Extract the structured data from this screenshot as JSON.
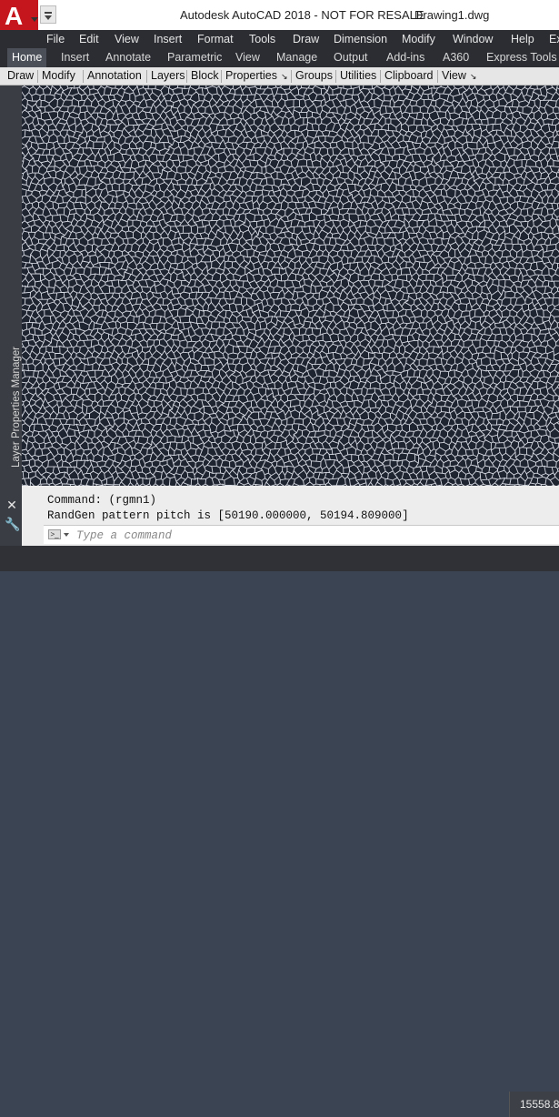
{
  "title_bar": {
    "app_title": "Autodesk AutoCAD 2018 - NOT FOR RESALE",
    "document": "Drawing1.dwg",
    "app_button_glyph": "A",
    "app_color": "#c4161c"
  },
  "menu": [
    {
      "label": "File"
    },
    {
      "label": "Edit"
    },
    {
      "label": "View"
    },
    {
      "label": "Insert"
    },
    {
      "label": "Format"
    },
    {
      "label": "Tools"
    },
    {
      "label": "Draw"
    },
    {
      "label": "Dimension"
    },
    {
      "label": "Modify"
    },
    {
      "label": "Window"
    },
    {
      "label": "Help"
    },
    {
      "label": "Ex"
    }
  ],
  "ribbon_tabs": [
    {
      "label": "Home",
      "active": true
    },
    {
      "label": "Insert"
    },
    {
      "label": "Annotate"
    },
    {
      "label": "Parametric"
    },
    {
      "label": "View"
    },
    {
      "label": "Manage"
    },
    {
      "label": "Output"
    },
    {
      "label": "Add-ins"
    },
    {
      "label": "A360"
    },
    {
      "label": "Express Tools"
    }
  ],
  "panels": [
    {
      "label": "Draw"
    },
    {
      "label": "Modify"
    },
    {
      "label": "Annotation"
    },
    {
      "label": "Layers"
    },
    {
      "label": "Block"
    },
    {
      "label": "Properties"
    },
    {
      "label": "Groups"
    },
    {
      "label": "Utilities"
    },
    {
      "label": "Clipboard"
    },
    {
      "label": "View"
    }
  ],
  "layer_palette": {
    "label": "Layer Properties Manager"
  },
  "command_window": {
    "history": [
      "Command: (rgmn1)",
      "RandGen pattern pitch is [50190.000000, 50194.809000]"
    ],
    "placeholder": "Type a command"
  },
  "status": {
    "coordinates": "15558.8"
  },
  "canvas_colors": {
    "background": "#1f2431",
    "lines": "#d7dbe3"
  },
  "icons": {
    "close": "close-icon",
    "customize": "wrench-icon",
    "prompt": "command-prompt-icon"
  }
}
